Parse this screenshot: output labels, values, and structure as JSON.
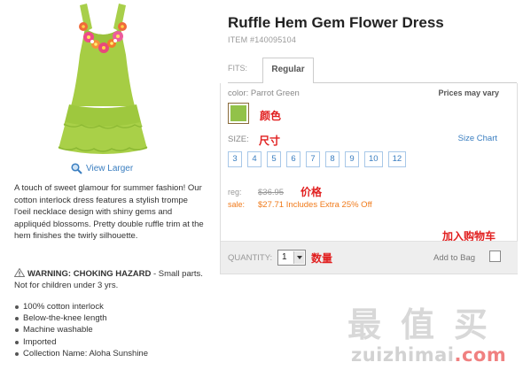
{
  "product": {
    "title": "Ruffle Hem Gem Flower Dress",
    "item_number": "ITEM #140095104",
    "view_larger": "View Larger",
    "description": "A touch of sweet glamour for summer fashion! Our cotton interlock dress features a stylish trompe l'oeil necklace design with shiny gems and appliquéd blossoms. Pretty double ruffle trim at the hem finishes the twirly silhouette.",
    "warning_label": "WARNING: CHOKING HAZARD",
    "warning_text": "- Small parts. Not for children under 3 yrs.",
    "features": [
      "100% cotton interlock",
      "Below-the-knee length",
      "Machine washable",
      "Imported",
      "Collection Name: Aloha Sunshine"
    ]
  },
  "fits": {
    "label": "FITS:",
    "selected": "Regular"
  },
  "options": {
    "color_label": "color: Parrot Green",
    "swatch_color": "#92c249",
    "prices_note": "Prices may vary",
    "size_label": "SIZE:",
    "size_chart": "Size Chart",
    "sizes": [
      "3",
      "4",
      "5",
      "6",
      "7",
      "8",
      "9",
      "10",
      "12"
    ]
  },
  "pricing": {
    "reg_label": "reg:",
    "reg_price": "$36.95",
    "sale_label": "sale:",
    "sale_price": "$27.71 Includes Extra 25% Off"
  },
  "quantity": {
    "label": "QUANTITY:",
    "value": "1",
    "add_to_bag": "Add to Bag"
  },
  "annotations": {
    "color": "颜色",
    "size": "尺寸",
    "price": "价格",
    "add_to_cart": "加入购物车",
    "quantity": "数量"
  },
  "watermark": {
    "chinese": [
      "最",
      "值",
      "买"
    ],
    "latin_main": "zuizhimai",
    "latin_tail": ".com"
  },
  "colors": {
    "accent_link": "#3a7ec0",
    "sale": "#f07a1a",
    "annotation": "#e12020"
  }
}
